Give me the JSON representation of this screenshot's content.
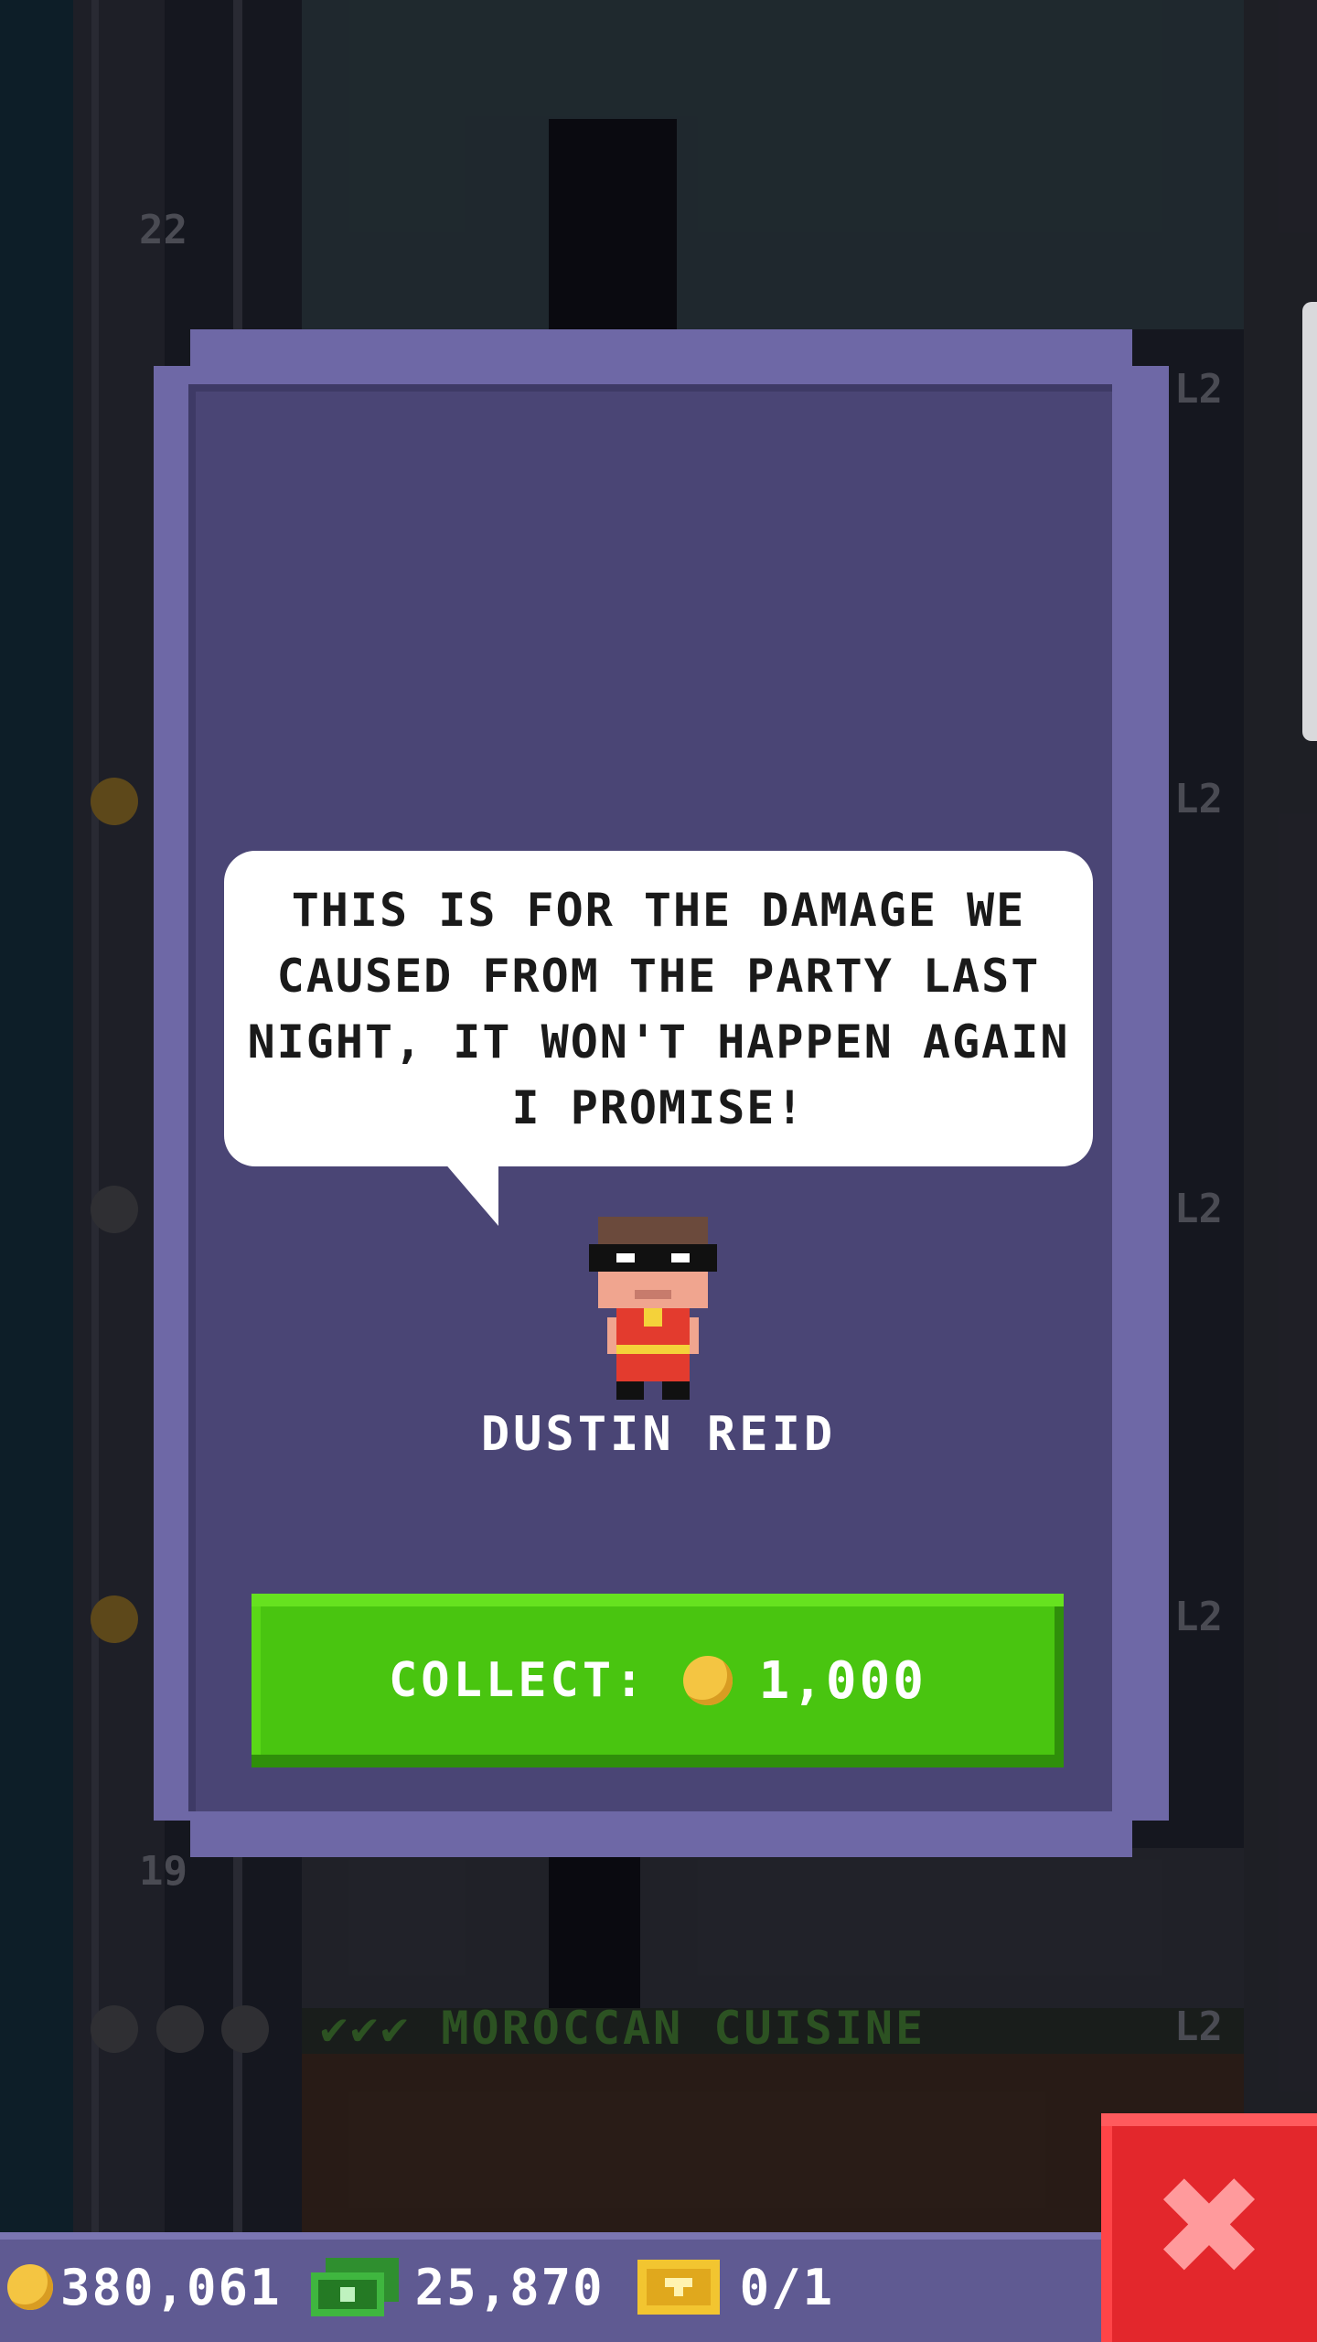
{
  "background": {
    "floor_numbers": [
      "22",
      "19"
    ],
    "floor_levels": [
      "L2",
      "L2",
      "L2",
      "L2",
      "L2"
    ],
    "floor_name": "MOROCCAN CUISINE"
  },
  "dialog": {
    "message": "THIS IS FOR THE DAMAGE WE CAUSED FROM THE PARTY LAST NIGHT, IT WON'T HAPPEN AGAIN I PROMISE!",
    "character_name": "DUSTIN REID",
    "collect_label": "COLLECT:",
    "collect_amount": "1,000",
    "collect_icon": "coin-icon"
  },
  "status_bar": {
    "coins": "380,061",
    "bux": "25,870",
    "tickets": "0/1"
  },
  "colors": {
    "modal_frame": "#6e68a6",
    "modal_panel": "#4a4575",
    "collect_button": "#49c510",
    "close_button": "#e3272c",
    "bar": "#5f5a92"
  }
}
